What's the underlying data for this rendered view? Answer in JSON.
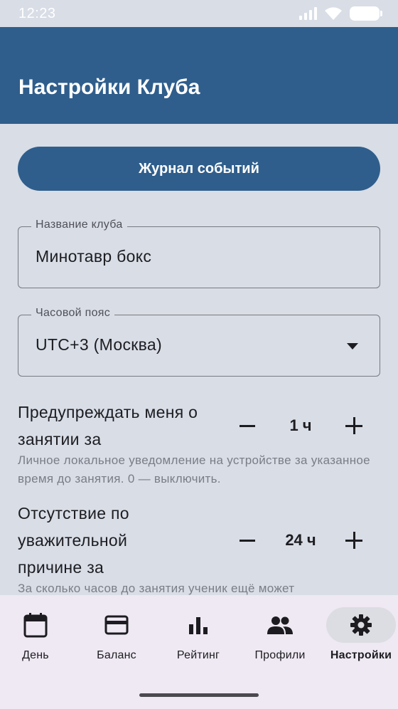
{
  "status_bar": {
    "time": "12:23"
  },
  "app_bar": {
    "title": "Настройки Клуба"
  },
  "journal_button": {
    "label": "Журнал событий"
  },
  "club_name_field": {
    "label": "Название клуба",
    "value": "Минотавр бокс"
  },
  "timezone_field": {
    "label": "Часовой пояс",
    "value": "UTC+3 (Москва)"
  },
  "reminder_setting": {
    "label": "Предупреждать меня о занятии за",
    "value": "1 ч",
    "description": "Личное локальное уведомление на устройстве за указанное время до занятия. 0 — выключить."
  },
  "absence_setting": {
    "label": "Отсутствие по уважительной причине за",
    "value": "24 ч",
    "description": "За сколько часов до занятия ученик ещё может"
  },
  "bottom_nav": {
    "items": [
      {
        "label": "День",
        "icon": "calendar-icon"
      },
      {
        "label": "Баланс",
        "icon": "card-icon"
      },
      {
        "label": "Рейтинг",
        "icon": "bar-chart-icon"
      },
      {
        "label": "Профили",
        "icon": "people-icon"
      },
      {
        "label": "Настройки",
        "icon": "gear-icon",
        "active": true
      }
    ]
  },
  "colors": {
    "primary": "#2f5e8c",
    "background": "#d8dde6",
    "nav_background": "#efe9f3"
  }
}
